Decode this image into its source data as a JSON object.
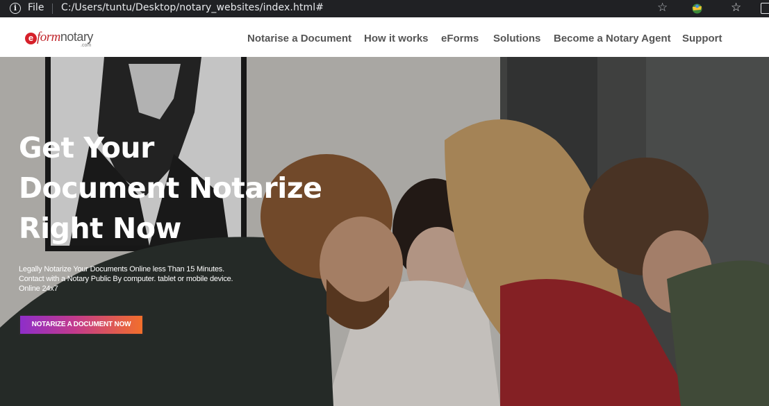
{
  "browser": {
    "scheme_label": "File",
    "url": "C:/Users/tuntu/Desktop/notary_websites/index.html#",
    "icons": [
      "info-icon",
      "star-icon",
      "extension-icon",
      "favorites-icon",
      "collections-icon"
    ]
  },
  "site": {
    "logo": {
      "e": "e",
      "form": "form",
      "notary": "notary",
      "com": ".com"
    },
    "nav": [
      {
        "label": "Notarise a Document"
      },
      {
        "label": "How it works"
      },
      {
        "label": "eForms"
      },
      {
        "label": "Solutions"
      },
      {
        "label": "Become a Notary Agent"
      },
      {
        "label": "Support"
      }
    ]
  },
  "hero": {
    "title_lines": [
      "Get Your",
      "Document Notarize",
      "Right Now"
    ],
    "subtitle_lines": [
      "Legally Notarize Your Documents Online less Than 15 Minutes.",
      "Contact with a Notary Public By computer. tablet or mobile device.",
      "Online 24x7"
    ],
    "cta_label": "NOTARIZE A DOCUMENT NOW"
  },
  "colors": {
    "address_bar": "#202124",
    "brand_red": "#c1272d",
    "nav_text": "#555555",
    "cta_gradient_start": "#8e2ec9",
    "cta_gradient_end": "#f26f2b"
  }
}
